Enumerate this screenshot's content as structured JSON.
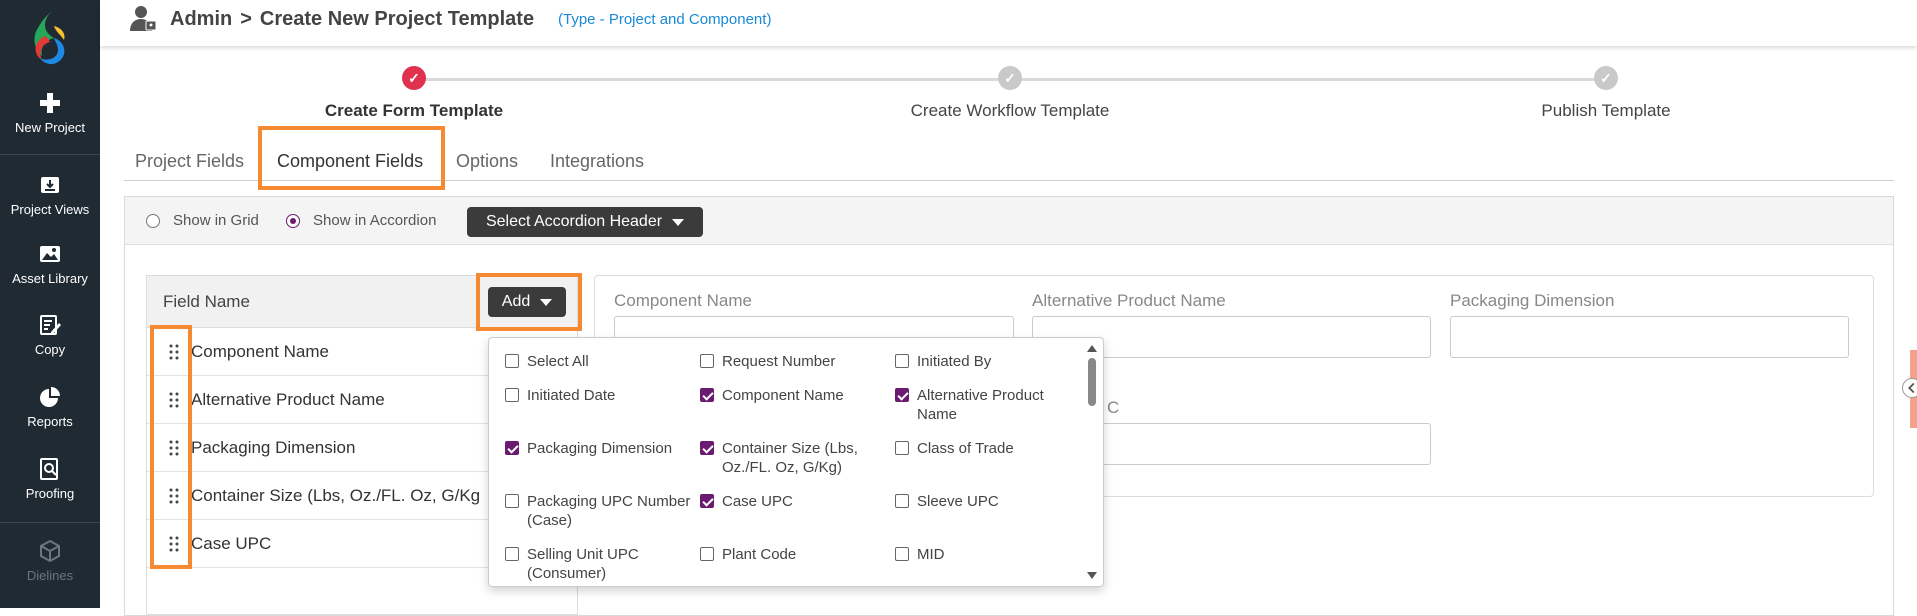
{
  "sidebar": {
    "items": [
      {
        "label": "New Project",
        "icon": "plus-icon"
      },
      {
        "label": "Project Views",
        "icon": "download-box-icon"
      },
      {
        "label": "Asset Library",
        "icon": "image-icon"
      },
      {
        "label": "Copy",
        "icon": "edit-document-icon"
      },
      {
        "label": "Reports",
        "icon": "pie-chart-icon"
      },
      {
        "label": "Proofing",
        "icon": "magnify-document-icon"
      },
      {
        "label": "Dielines",
        "icon": "cube-icon"
      }
    ]
  },
  "header": {
    "section": "Admin",
    "separator": ">",
    "page_title": "Create New Project Template",
    "type_note": "(Type - Project and Component)"
  },
  "stepper": {
    "steps": [
      {
        "label": "Create Form Template",
        "state": "active"
      },
      {
        "label": "Create Workflow Template",
        "state": "pending"
      },
      {
        "label": "Publish Template",
        "state": "pending"
      }
    ],
    "active_color": "#e0314f"
  },
  "tabs": [
    {
      "label": "Project Fields"
    },
    {
      "label": "Component Fields"
    },
    {
      "label": "Options"
    },
    {
      "label": "Integrations"
    }
  ],
  "display_options": {
    "grid_label": "Show in Grid",
    "accordion_label": "Show in Accordion",
    "selected": "accordion",
    "accordion_header_button": "Select Accordion Header"
  },
  "field_list": {
    "title": "Field Name",
    "add_button": "Add",
    "rows": [
      "Component Name",
      "Alternative Product Name",
      "Packaging Dimension",
      "Container Size (Lbs, Oz./FL. Oz, G/Kg",
      "Case UPC"
    ]
  },
  "form": {
    "labels": [
      "Component Name",
      "Alternative Product Name",
      "Packaging Dimension"
    ],
    "partial_label": "C"
  },
  "add_dropdown": {
    "items": [
      {
        "label": "Select All",
        "checked": false
      },
      {
        "label": "Request Number",
        "checked": false
      },
      {
        "label": "Initiated By",
        "checked": false
      },
      {
        "label": "Initiated Date",
        "checked": false
      },
      {
        "label": "Component Name",
        "checked": true
      },
      {
        "label": "Alternative Product Name",
        "checked": true
      },
      {
        "label": "Packaging Dimension",
        "checked": true
      },
      {
        "label": "Container Size (Lbs, Oz./FL. Oz, G/Kg)",
        "checked": true
      },
      {
        "label": "Class of Trade",
        "checked": false
      },
      {
        "label": "Packaging UPC Number (Case)",
        "checked": false
      },
      {
        "label": "Case UPC",
        "checked": true
      },
      {
        "label": "Sleeve UPC",
        "checked": false
      },
      {
        "label": "Selling Unit UPC (Consumer)",
        "checked": false
      },
      {
        "label": "Plant Code",
        "checked": false
      },
      {
        "label": "MID",
        "checked": false
      }
    ]
  },
  "colors": {
    "sidebar_bg": "#1f2a33",
    "accent_purple": "#6a1b6f",
    "highlight_orange": "#f58a32",
    "link_blue": "#1a8ad6"
  }
}
